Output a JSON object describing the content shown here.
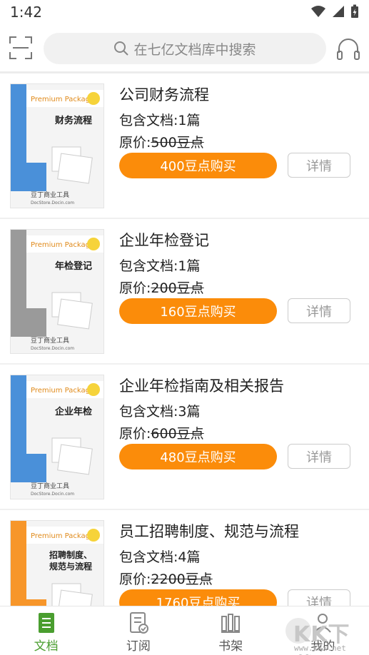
{
  "status_bar": {
    "time": "1:42"
  },
  "search": {
    "placeholder": "在七亿文档库中搜索"
  },
  "items": [
    {
      "title": "公司财务流程",
      "docs": "包含文档:1篇",
      "price_label": "原价:",
      "original_price": "500豆点",
      "buy_label": "400豆点购买",
      "detail_label": "详情",
      "cover_title": "财务流程",
      "cover_color": "#4a90d9"
    },
    {
      "title": "企业年检登记",
      "docs": "包含文档:1篇",
      "price_label": "原价:",
      "original_price": "200豆点",
      "buy_label": "160豆点购买",
      "detail_label": "详情",
      "cover_title": "年检登记",
      "cover_color": "#9a9a9a"
    },
    {
      "title": "企业年检指南及相关报告",
      "docs": "包含文档:3篇",
      "price_label": "原价:",
      "original_price": "600豆点",
      "buy_label": "480豆点购买",
      "detail_label": "详情",
      "cover_title": "企业年检",
      "cover_color": "#4a90d9"
    },
    {
      "title": "员工招聘制度、规范与流程",
      "docs": "包含文档:4篇",
      "price_label": "原价:",
      "original_price": "2200豆点",
      "buy_label": "1760豆点购买",
      "detail_label": "详情",
      "cover_title_1": "招聘制度、",
      "cover_title_2": "规范与流程",
      "cover_color": "#f7962a"
    }
  ],
  "cover_common": {
    "package_text": "Premium Package",
    "footer_text": "豆丁商业工具",
    "footer_sub": "DocStore.Docin.com",
    "side_text": "Docin.com"
  },
  "nav": [
    {
      "label": "文档",
      "icon": "document-icon",
      "active": true
    },
    {
      "label": "订阅",
      "icon": "subscribe-icon",
      "active": false
    },
    {
      "label": "书架",
      "icon": "bookshelf-icon",
      "active": false
    },
    {
      "label": "我的",
      "icon": "profile-icon",
      "active": false
    }
  ],
  "watermark": {
    "text": "KK下载",
    "sub": "www.kkx.net"
  },
  "colors": {
    "accent_orange": "#fb8c0a",
    "active_green": "#4a9e2f"
  }
}
